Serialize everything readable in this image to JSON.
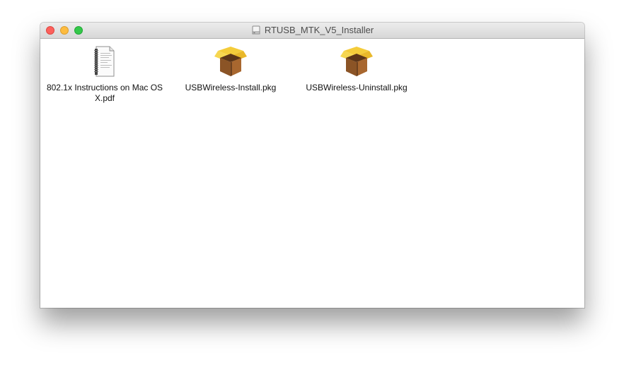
{
  "window": {
    "title": "RTUSB_MTK_V5_Installer",
    "title_icon": "drive-icon"
  },
  "files": [
    {
      "name": "802.1x Instructions on Mac OS X.pdf",
      "icon": "pdf-document-icon"
    },
    {
      "name": "USBWireless-Install.pkg",
      "icon": "package-icon"
    },
    {
      "name": "USBWireless-Uninstall.pkg",
      "icon": "package-icon"
    }
  ],
  "colors": {
    "close": "#fc605c",
    "minimize": "#fdbc40",
    "maximize": "#34c84a"
  }
}
